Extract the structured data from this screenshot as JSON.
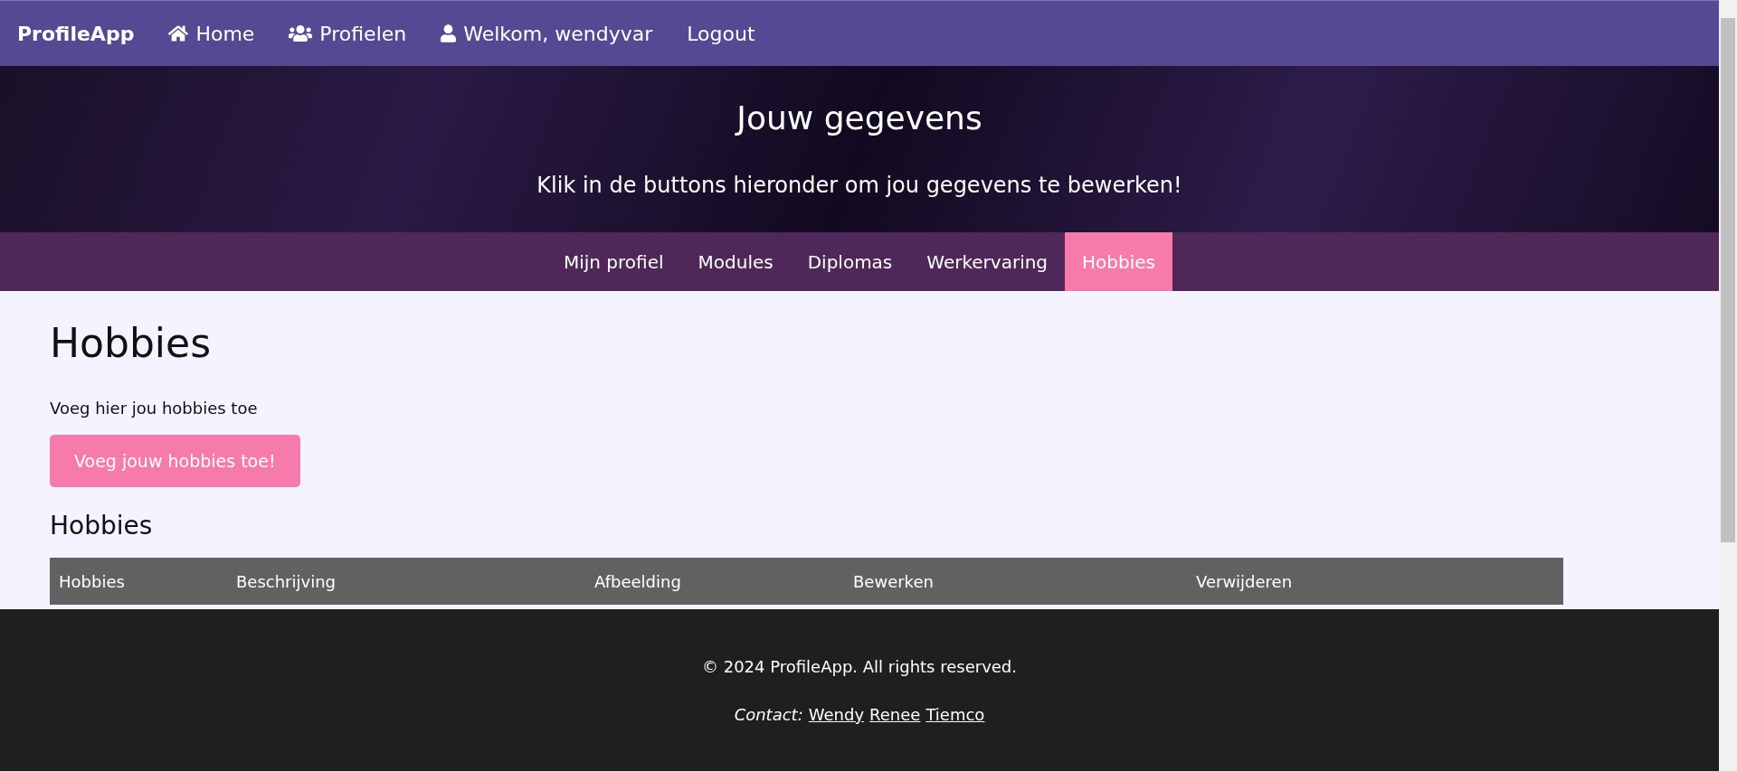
{
  "navbar": {
    "brand": "ProfileApp",
    "items": [
      {
        "label": "Home",
        "kind": "home"
      },
      {
        "label": "Profielen",
        "kind": "group"
      },
      {
        "label": "Welkom, wendyvar",
        "kind": "account"
      },
      {
        "label": "Logout",
        "kind": "plain"
      }
    ]
  },
  "hero": {
    "title": "Jouw gegevens",
    "subtitle": "Klik in de buttons hieronder om jou gegevens te bewerken!"
  },
  "tabs": [
    {
      "label": "Mijn profiel",
      "selected": false
    },
    {
      "label": "Modules",
      "selected": false
    },
    {
      "label": "Diplomas",
      "selected": false
    },
    {
      "label": "Werkervaring",
      "selected": false
    },
    {
      "label": "Hobbies",
      "selected": true
    }
  ],
  "content": {
    "heading": "Hobbies",
    "intro": "Voeg hier jou hobbies toe",
    "button": "Voeg jouw hobbies toe!",
    "subheading": "Hobbies",
    "table": {
      "columns": [
        "Hobbies",
        "Beschrijving",
        "Afbeelding",
        "Bewerken",
        "Verwijderen"
      ]
    }
  },
  "footer": {
    "copyright": "© 2024 ProfileApp. All rights reserved.",
    "contact_label": "Contact:",
    "links": [
      "Wendy",
      "Renee",
      "Tiemco"
    ]
  }
}
